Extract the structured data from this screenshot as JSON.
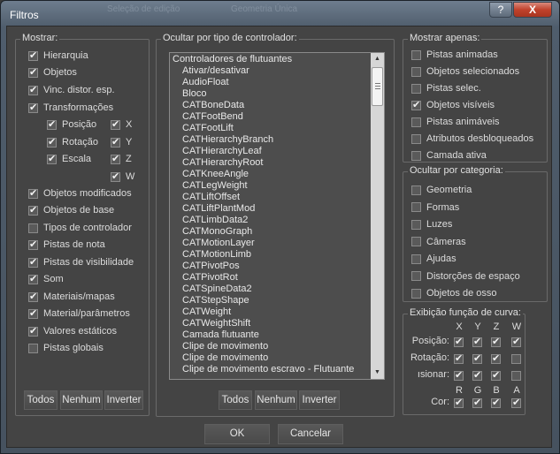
{
  "window": {
    "title": "Filtros",
    "ghost_text_1": "Seleção de edição",
    "ghost_text_2": "Geometria Única",
    "help_label": "?",
    "close_label": "X"
  },
  "show": {
    "title": "Mostrar:",
    "items": [
      {
        "label": "Hierarquia",
        "checked": true
      },
      {
        "label": "Objetos",
        "checked": true
      },
      {
        "label": "Vinc. distor. esp.",
        "checked": true
      },
      {
        "label": "Transformações",
        "checked": true
      },
      {
        "label": "Objetos modificados",
        "checked": true
      },
      {
        "label": "Objetos de base",
        "checked": true
      },
      {
        "label": "Tipos de controlador",
        "checked": false
      },
      {
        "label": "Pistas de nota",
        "checked": true
      },
      {
        "label": "Pistas de visibilidade",
        "checked": true
      },
      {
        "label": "Som",
        "checked": true
      },
      {
        "label": "Materiais/mapas",
        "checked": true
      },
      {
        "label": "Material/parâmetros",
        "checked": true
      },
      {
        "label": "Valores estáticos",
        "checked": true
      },
      {
        "label": "Pistas globais",
        "checked": false
      }
    ],
    "transform_sub": [
      {
        "label": "Posição",
        "checked": true
      },
      {
        "label": "Rotação",
        "checked": true
      },
      {
        "label": "Escala",
        "checked": true
      }
    ],
    "axes": [
      {
        "label": "X",
        "checked": true
      },
      {
        "label": "Y",
        "checked": true
      },
      {
        "label": "Z",
        "checked": true
      },
      {
        "label": "W",
        "checked": true
      }
    ],
    "buttons": {
      "all": "Todos",
      "none": "Nenhum",
      "invert": "Inverter"
    }
  },
  "controller": {
    "title": "Ocultar por tipo de controlador:",
    "items": [
      "Controladores de flutuantes",
      "Ativar/desativar",
      "AudioFloat",
      "Bloco",
      "CATBoneData",
      "CATFootBend",
      "CATFootLift",
      "CATHierarchyBranch",
      "CATHierarchyLeaf",
      "CATHierarchyRoot",
      "CATKneeAngle",
      "CATLegWeight",
      "CATLiftOffset",
      "CATLiftPlantMod",
      "CATLimbData2",
      "CATMonoGraph",
      "CATMotionLayer",
      "CATMotionLimb",
      "CATPivotPos",
      "CATPivotRot",
      "CATSpineData2",
      "CATStepShape",
      "CATWeight",
      "CATWeightShift",
      "Camada flutuante",
      "Clipe de movimento",
      "Clipe de movimento",
      "Clipe de movimento escravo - Flutuante"
    ],
    "buttons": {
      "all": "Todos",
      "none": "Nenhum",
      "invert": "Inverter"
    }
  },
  "show_only": {
    "title": "Mostrar apenas:",
    "items": [
      {
        "label": "Pistas animadas",
        "checked": false
      },
      {
        "label": "Objetos selecionados",
        "checked": false
      },
      {
        "label": "Pistas selec.",
        "checked": false
      },
      {
        "label": "Objetos visíveis",
        "checked": true
      },
      {
        "label": "Pistas animáveis",
        "checked": false
      },
      {
        "label": "Atributos desbloqueados",
        "checked": false
      },
      {
        "label": "Camada ativa",
        "checked": false
      }
    ]
  },
  "hide_category": {
    "title": "Ocultar por categoria:",
    "items": [
      {
        "label": "Geometria",
        "checked": false
      },
      {
        "label": "Formas",
        "checked": false
      },
      {
        "label": "Luzes",
        "checked": false
      },
      {
        "label": "Câmeras",
        "checked": false
      },
      {
        "label": "Ajudas",
        "checked": false
      },
      {
        "label": "Distorções de espaço",
        "checked": false
      },
      {
        "label": "Objetos de osso",
        "checked": false
      }
    ]
  },
  "curve": {
    "title": "Exibição função de curva:",
    "cols_xyzw": [
      "X",
      "Y",
      "Z",
      "W"
    ],
    "rows": [
      {
        "label": "Posição:",
        "checks": [
          true,
          true,
          true,
          true
        ]
      },
      {
        "label": "Rotação:",
        "checks": [
          true,
          true,
          true,
          false
        ]
      },
      {
        "label": "ısionar:",
        "checks": [
          true,
          true,
          true,
          false
        ]
      }
    ],
    "cols_rgba": [
      "R",
      "G",
      "B",
      "A"
    ],
    "color_row": {
      "label": "Cor:",
      "checks": [
        true,
        true,
        true,
        true
      ]
    }
  },
  "footer": {
    "ok": "OK",
    "cancel": "Cancelar"
  }
}
